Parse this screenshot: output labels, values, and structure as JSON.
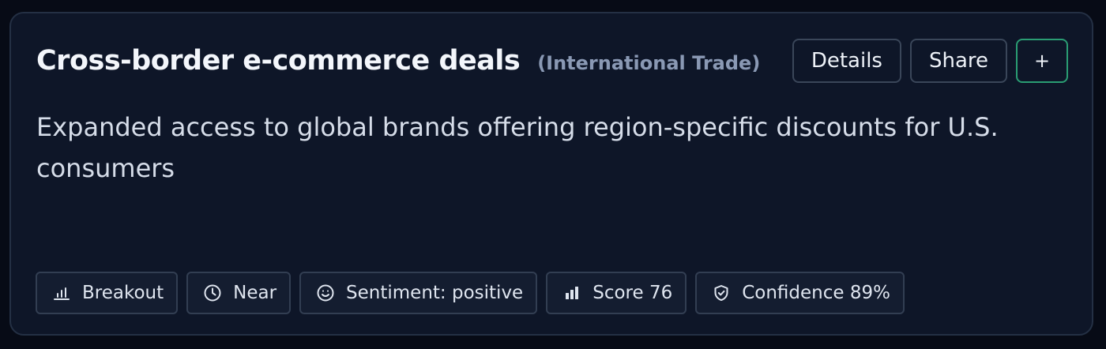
{
  "card": {
    "title": "Cross-border e-commerce deals",
    "category": "(International Trade)",
    "description": "Expanded access to global brands offering region-specific discounts for U.S. consumers",
    "actions": {
      "details_label": "Details",
      "share_label": "Share",
      "add_label": "+"
    },
    "tags": [
      {
        "icon": "bar-chart-icon",
        "label": "Breakout"
      },
      {
        "icon": "clock-icon",
        "label": "Near"
      },
      {
        "icon": "smiley-icon",
        "label": "Sentiment: positive"
      },
      {
        "icon": "bar-chart-bold-icon",
        "label": "Score 76"
      },
      {
        "icon": "shield-check-icon",
        "label": "Confidence 89%"
      }
    ]
  },
  "colors": {
    "background": "#070b16",
    "card": "#0e1628",
    "accent": "#2a9d73",
    "text": "#f3f6fb",
    "muted": "#8a99b4"
  }
}
